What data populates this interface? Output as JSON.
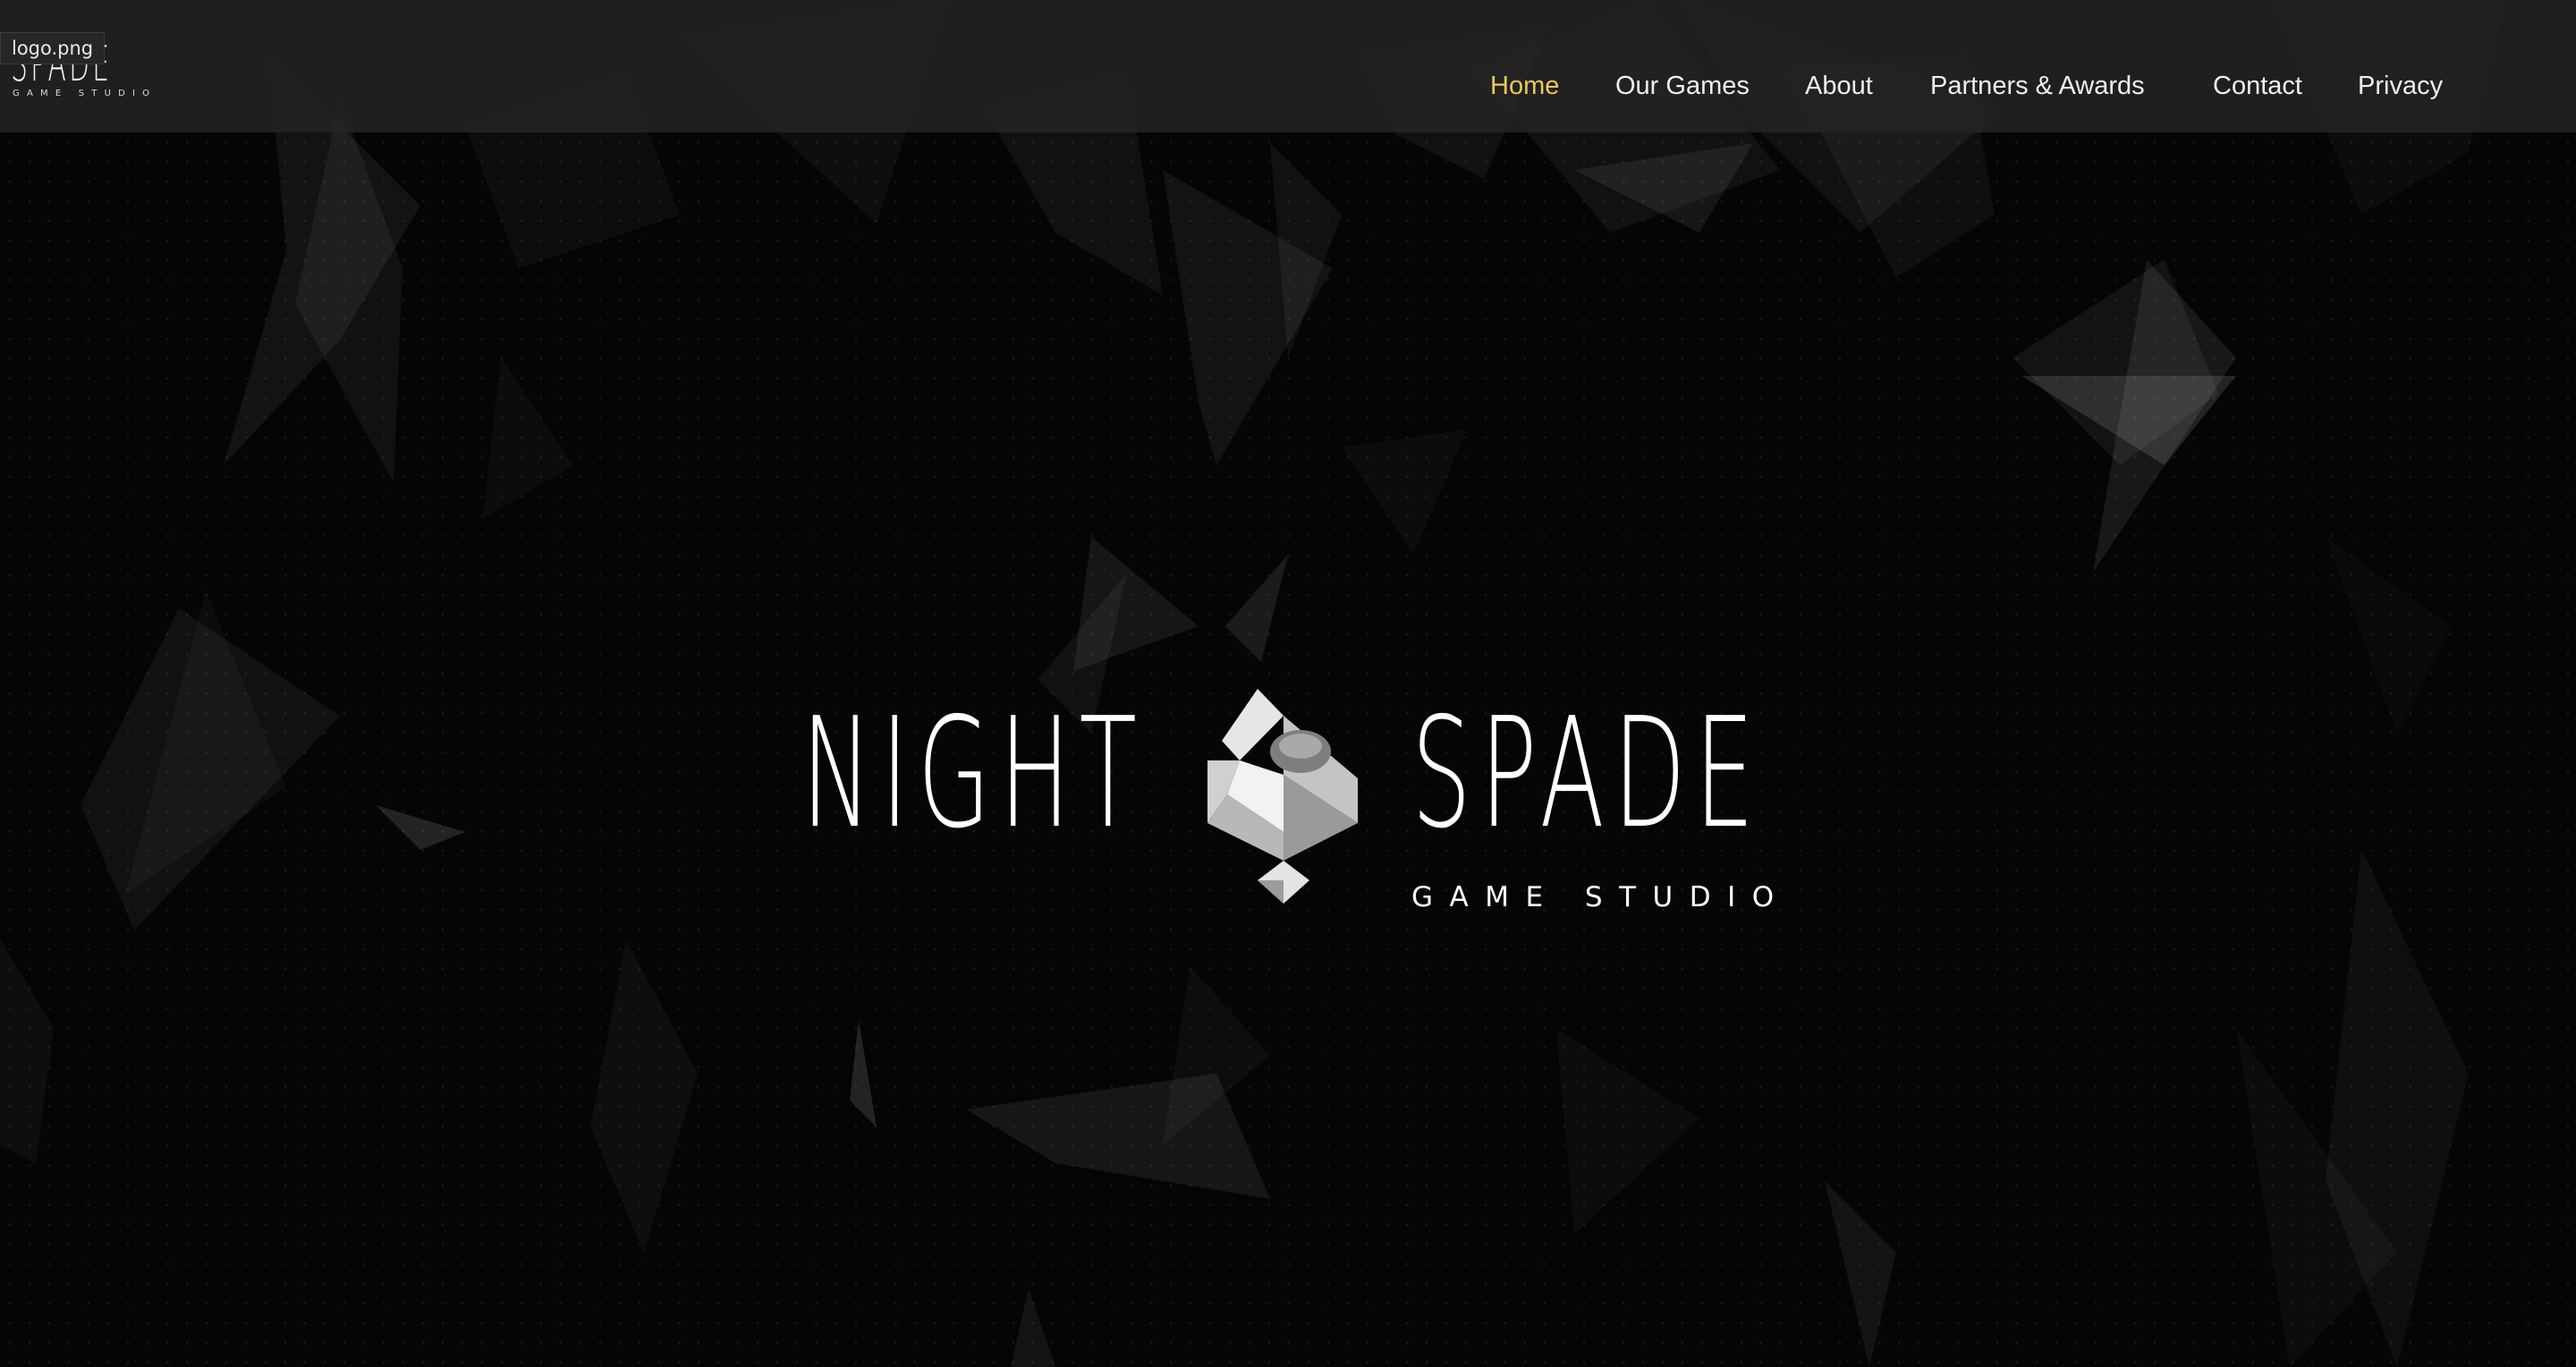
{
  "header": {
    "logo": {
      "word": "SPADE",
      "tagline": "GAME STUDIO"
    },
    "logo_file_label": "logo.png",
    "nav": [
      {
        "label": "Home",
        "active": true
      },
      {
        "label": "Our Games",
        "active": false
      },
      {
        "label": "About",
        "active": false
      },
      {
        "label": "Partners & Awards",
        "active": false
      },
      {
        "label": "Contact",
        "active": false
      },
      {
        "label": "Privacy",
        "active": false
      }
    ]
  },
  "hero": {
    "word_left": "NIGHT",
    "word_right": "SPADE",
    "tagline": "GAME STUDIO",
    "icon": "spade-icon"
  },
  "colors": {
    "background": "#050505",
    "header_bg": "#242424",
    "nav_text": "#efefef",
    "nav_active": "#e8c95a",
    "logo_text": "#ffffff"
  }
}
